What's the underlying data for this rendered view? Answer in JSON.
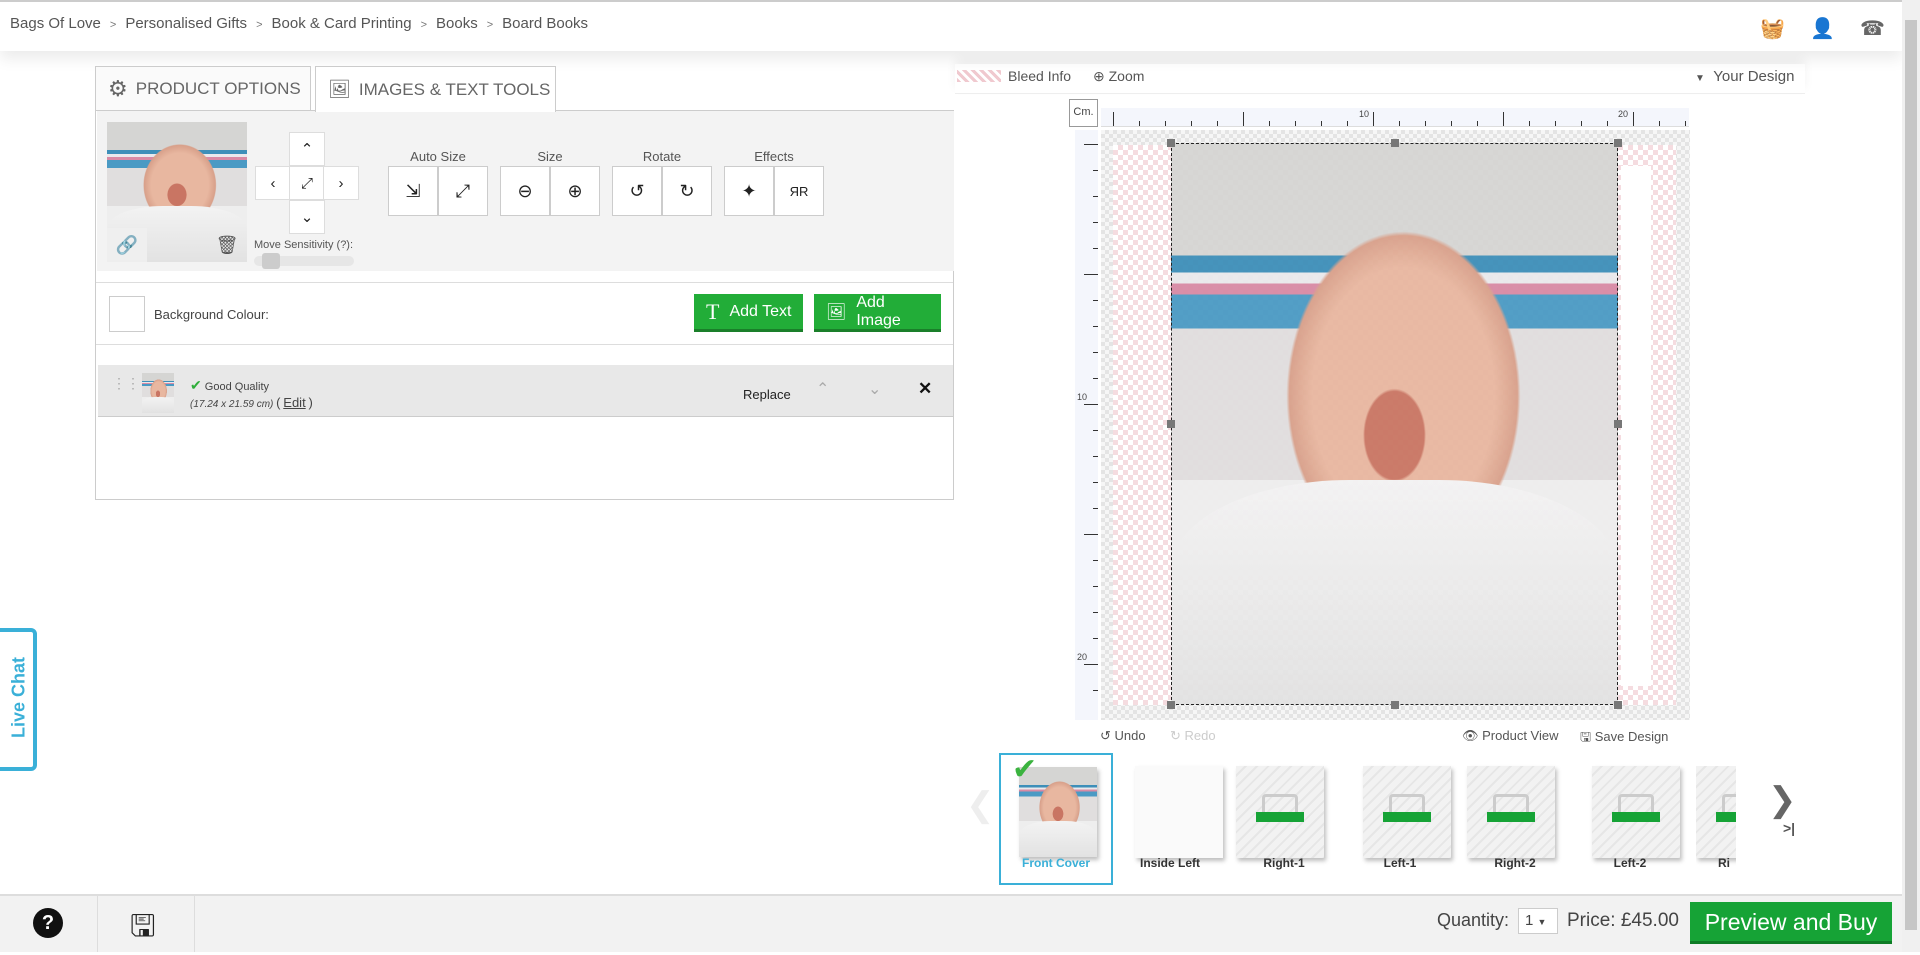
{
  "breadcrumb": [
    "Bags Of Love",
    "Personalised Gifts",
    "Book & Card Printing",
    "Books",
    "Board Books"
  ],
  "breadcrumb_sep": ">",
  "header_icons": [
    "basket-icon",
    "user-icon",
    "phone-icon"
  ],
  "tabs": [
    {
      "label": "PRODUCT OPTIONS",
      "icon": "gear-icon"
    },
    {
      "label": "IMAGES & TEXT TOOLS",
      "icon": "image-icon",
      "active": true
    }
  ],
  "tools": {
    "auto_size": "Auto Size",
    "size": "Size",
    "rotate": "Rotate",
    "effects": "Effects",
    "move_sensitivity": "Move Sensitivity (?):",
    "sensitivity_value": 0.1
  },
  "background": {
    "label": "Background Colour:",
    "color": "#ffffff"
  },
  "buttons": {
    "add_text": "Add Text",
    "add_image": "Add Image"
  },
  "layer": {
    "quality": "Good Quality",
    "dimensions": "(17.24 x 21.59 cm)",
    "edit_open": "(",
    "edit": "Edit",
    "edit_close": ")",
    "replace": "Replace"
  },
  "editor": {
    "bleed_info": "Bleed Info",
    "zoom": "Zoom",
    "your_design": "Your Design",
    "unit": "Cm.",
    "ruler_top": [
      "10",
      "20"
    ],
    "ruler_left": [
      "10",
      "20"
    ],
    "undo": "Undo",
    "redo": "Redo",
    "product_view": "Product View",
    "save_design": "Save Design"
  },
  "pages": [
    {
      "label": "Front Cover",
      "active": true,
      "done": true
    },
    {
      "label": "Inside Left"
    },
    {
      "label": "Right-1"
    },
    {
      "label": "Left-1"
    },
    {
      "label": "Right-2"
    },
    {
      "label": "Left-2"
    },
    {
      "label": "Ri"
    }
  ],
  "footer": {
    "quantity_label": "Quantity:",
    "quantity": "1",
    "price": "Price: £45.00",
    "preview_buy": "Preview and Buy"
  },
  "live_chat": "Live Chat",
  "colors": {
    "accent_green": "#22ad38",
    "active_blue": "#3ab0d8"
  }
}
